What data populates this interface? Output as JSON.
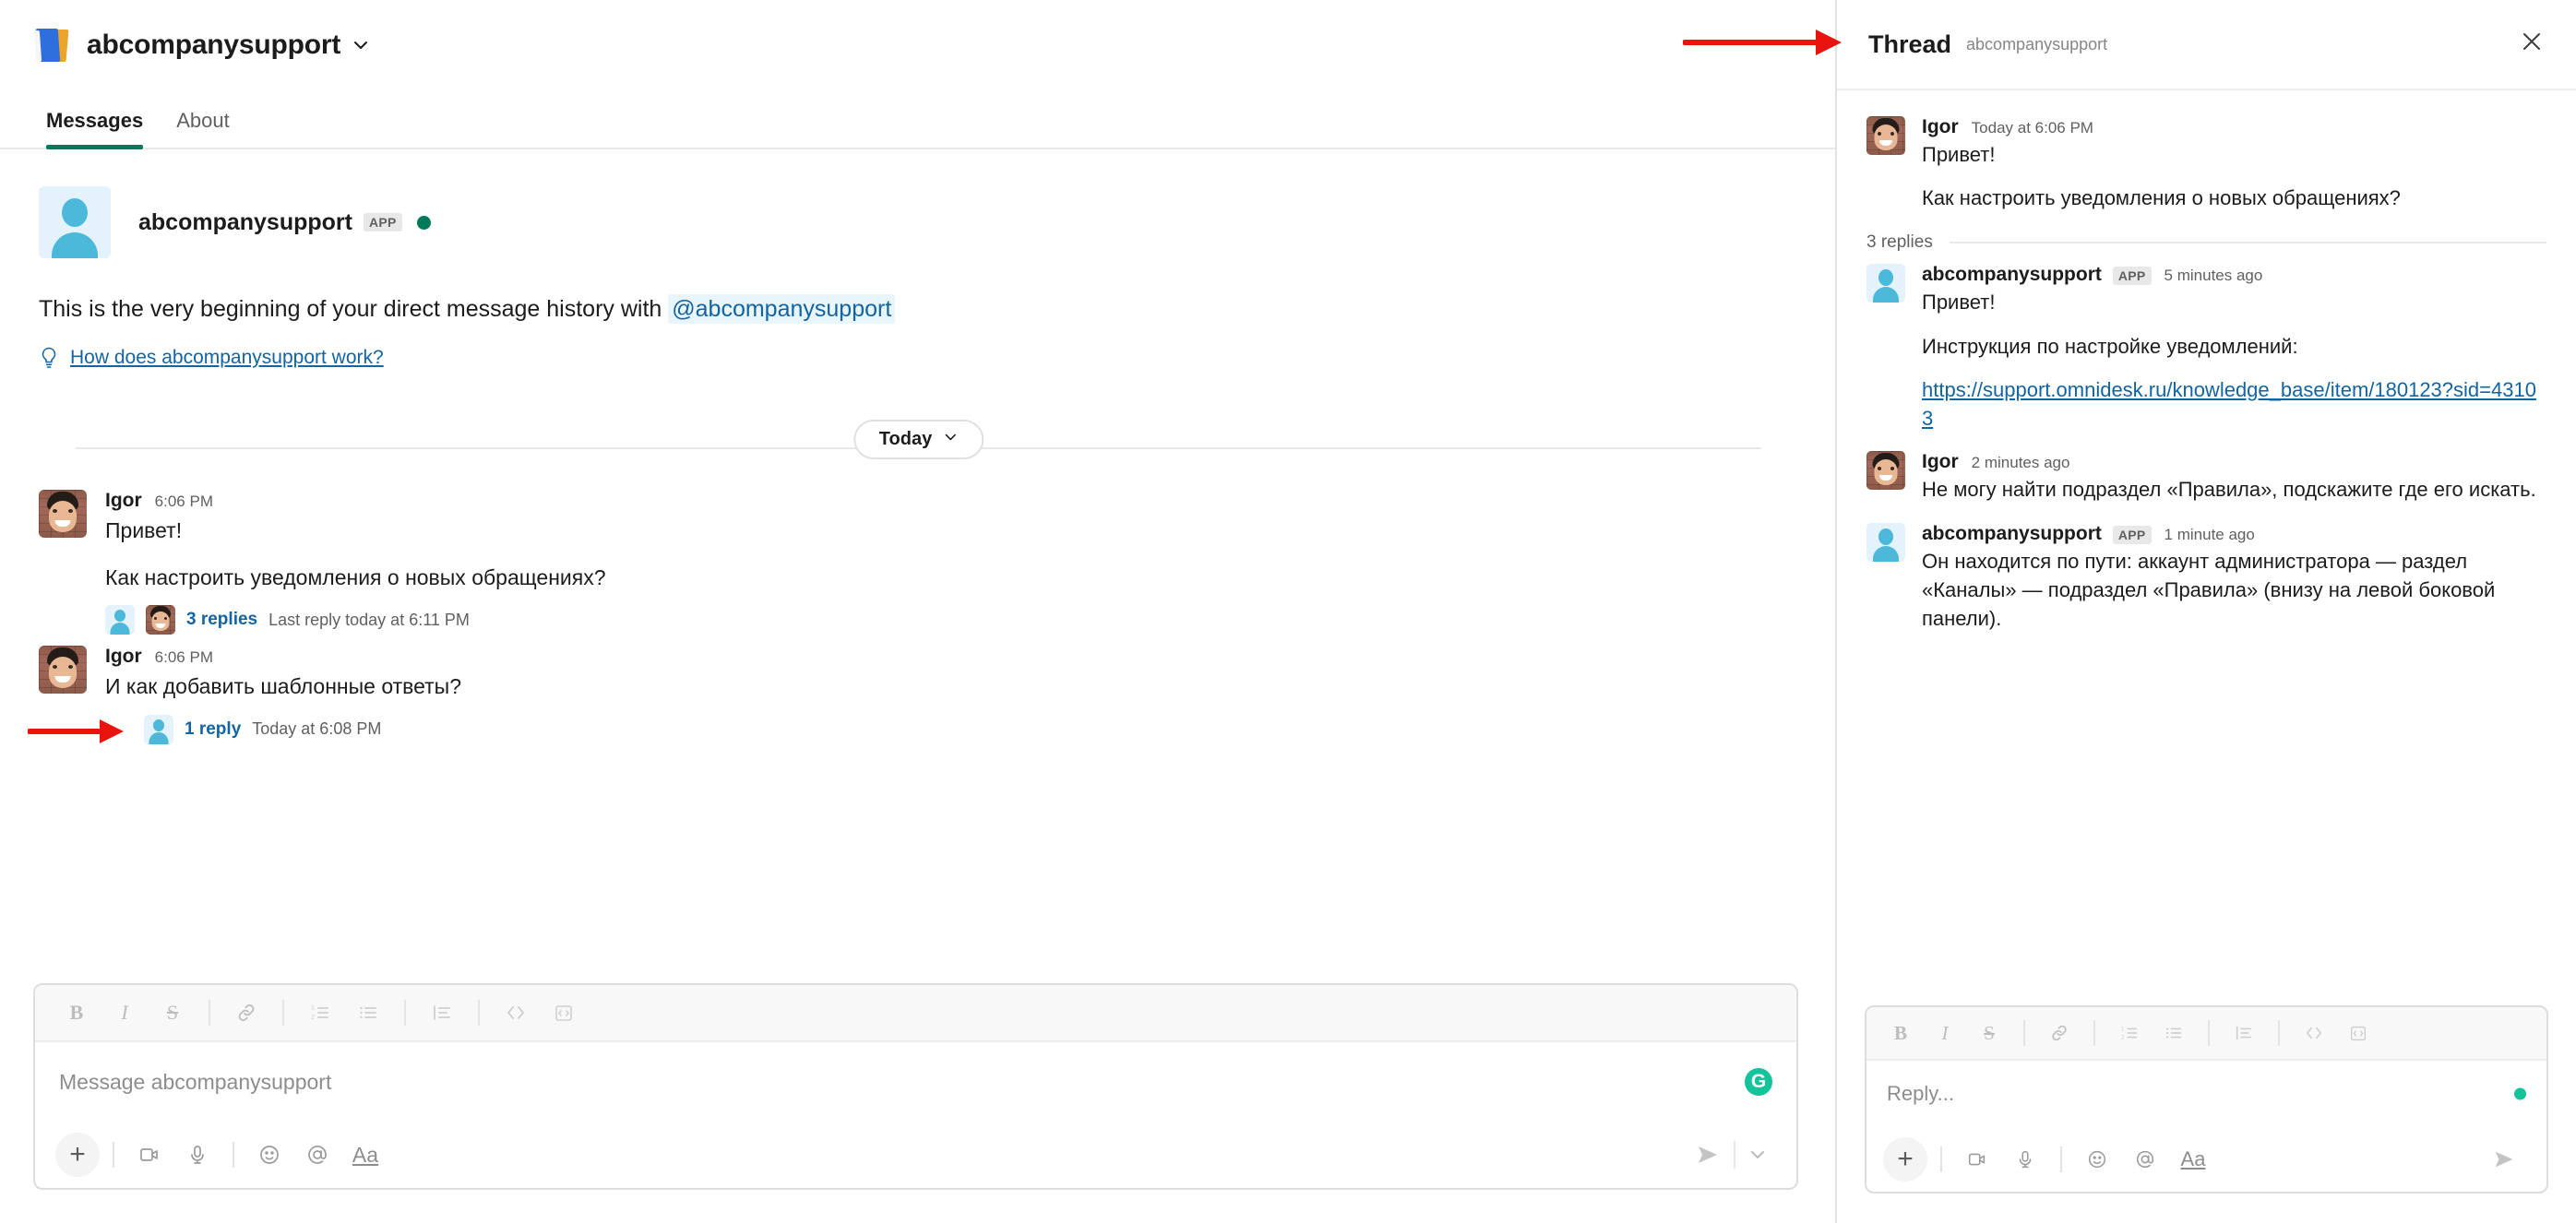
{
  "header": {
    "app_icon": "book-icon",
    "title": "abcompanysupport",
    "chevron": "chevron-down-icon"
  },
  "tabs": [
    {
      "label": "Messages",
      "active": true
    },
    {
      "label": "About",
      "active": false
    }
  ],
  "intro": {
    "name": "abcompanysupport",
    "app_badge": "APP",
    "presence": "online",
    "presence_color": "#007a5a",
    "beginning_text": "This is the very beginning of your direct message history with",
    "mention": "@abcompanysupport",
    "help_link": "How does abcompanysupport work?",
    "help_icon": "lightbulb-icon"
  },
  "date_divider": {
    "label": "Today",
    "chevron": "chevron-down-icon"
  },
  "messages": [
    {
      "author": "Igor",
      "avatar": "photo-avatar",
      "time": "6:06 PM",
      "lines": [
        "Привет!",
        "Как настроить уведомления о новых обращениях?"
      ],
      "thread": {
        "replies_label": "3 replies",
        "meta": "Last reply today at 6:11 PM"
      }
    },
    {
      "author": "Igor",
      "avatar": "photo-avatar",
      "time": "6:06 PM",
      "lines": [
        "И как добавить шаблонные ответы?"
      ],
      "thread": {
        "replies_label": "1 reply",
        "meta": "Today at 6:08 PM"
      }
    }
  ],
  "composer": {
    "placeholder": "Message abcompanysupport",
    "grammarly": "G",
    "format_buttons": [
      "bold-icon",
      "italic-icon",
      "strikethrough-icon",
      "link-icon",
      "ordered-list-icon",
      "bulleted-list-icon",
      "blockquote-icon",
      "code-icon",
      "code-block-icon"
    ],
    "action_buttons": [
      "plus-icon",
      "video-icon",
      "microphone-icon",
      "emoji-icon",
      "mention-icon",
      "formatting-icon"
    ],
    "send": "send-icon",
    "send_options": "chevron-down-icon"
  },
  "thread_panel": {
    "title": "Thread",
    "subtitle": "abcompanysupport",
    "close": "close-icon",
    "root": {
      "author": "Igor",
      "avatar": "photo-avatar",
      "time": "Today at 6:06 PM",
      "lines": [
        "Привет!",
        "Как настроить уведомления о новых обращениях?"
      ]
    },
    "replies_count": "3 replies",
    "replies": [
      {
        "author": "abcompanysupport",
        "app_badge": "APP",
        "avatar": "app-avatar",
        "time": "5 minutes ago",
        "lines": [
          "Привет!",
          "Инструкция по настройке уведомлений:"
        ],
        "link": "https://support.omnidesk.ru/knowledge_base/item/180123?sid=43103"
      },
      {
        "author": "Igor",
        "avatar": "photo-avatar",
        "time": "2 minutes ago",
        "lines": [
          "Не могу найти подраздел «Правила», подскажите где его искать."
        ]
      },
      {
        "author": "abcompanysupport",
        "app_badge": "APP",
        "avatar": "app-avatar",
        "time": "1 minute ago",
        "lines": [
          "Он находится по пути: аккаунт администратора — раздел «Каналы» — подраздел «Правила» (внизу на левой боковой панели)."
        ]
      }
    ],
    "composer": {
      "placeholder": "Reply...",
      "grammarly_dot_color": "#15c39a",
      "send": "send-icon"
    }
  },
  "annotations": {
    "arrow_color": "#e8140d",
    "arrow_thread": "red-arrow-pointing-to-thread-title",
    "arrow_replies": "red-arrow-pointing-to-3-replies"
  }
}
